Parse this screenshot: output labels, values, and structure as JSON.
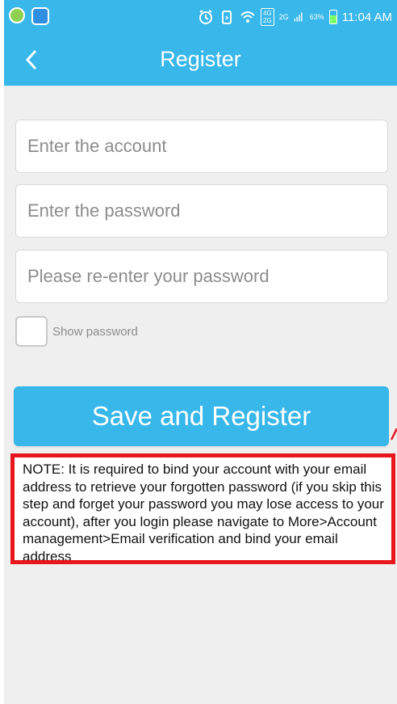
{
  "status_bar": {
    "network_badge": "4G\n2G",
    "network_type": "2G",
    "battery_percent": "63%",
    "battery_level": 0.63,
    "time": "11:04 AM"
  },
  "header": {
    "title": "Register"
  },
  "form": {
    "account_placeholder": "Enter the account",
    "password_placeholder": "Enter the password",
    "confirm_placeholder": "Please re-enter your password",
    "show_password_label": "Show password",
    "show_password_checked": false,
    "submit_label": "Save and Register"
  },
  "note": {
    "text": "NOTE: It is required to bind your account with your email address to retrieve your forgotten password (if you skip this step and forget your password you may lose access to your account), after you login please navigate to More>Account management>Email verification and bind your email address"
  },
  "colors": {
    "accent": "#37b7ea",
    "note_border": "#e8151d",
    "background": "#efeff0"
  }
}
